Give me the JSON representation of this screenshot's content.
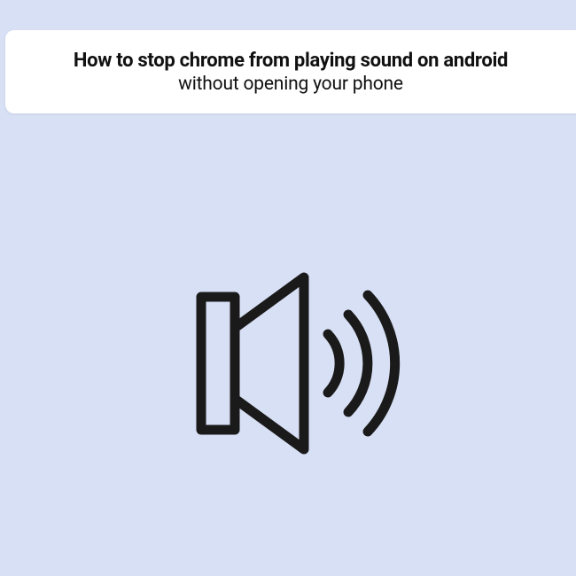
{
  "header": {
    "title": "How to stop chrome from playing sound on android",
    "subtitle": "without opening your phone"
  },
  "icon": {
    "name": "speaker-icon",
    "stroke": "#1a1a1a"
  }
}
